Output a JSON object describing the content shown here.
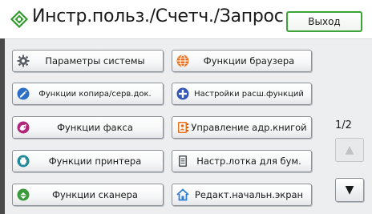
{
  "header": {
    "title": "Инстр.польз./Счетч./Запрос",
    "exit_label": "Выход"
  },
  "menu": {
    "left": [
      {
        "label": "Параметры системы",
        "icon": "gear-icon"
      },
      {
        "label": "Функции копира/серв.док.",
        "icon": "copier-icon"
      },
      {
        "label": "Функции факса",
        "icon": "fax-icon"
      },
      {
        "label": "Функции принтера",
        "icon": "printer-icon"
      },
      {
        "label": "Функции сканера",
        "icon": "scanner-icon"
      }
    ],
    "right": [
      {
        "label": "Функции браузера",
        "icon": "browser-globe-icon"
      },
      {
        "label": "Настройки расш.функций",
        "icon": "extended-features-icon"
      },
      {
        "label": "Управление адр.книгой",
        "icon": "address-book-icon"
      },
      {
        "label": "Настр.лотка для бум.",
        "icon": "paper-tray-icon"
      },
      {
        "label": "Редакт.начальн.экран",
        "icon": "home-icon"
      }
    ]
  },
  "pager": {
    "indicator": "1/2",
    "up_symbol": "▲",
    "down_symbol": "▼"
  },
  "colors": {
    "accent_green": "#3ca336",
    "panel_bg": "#eceef0"
  }
}
